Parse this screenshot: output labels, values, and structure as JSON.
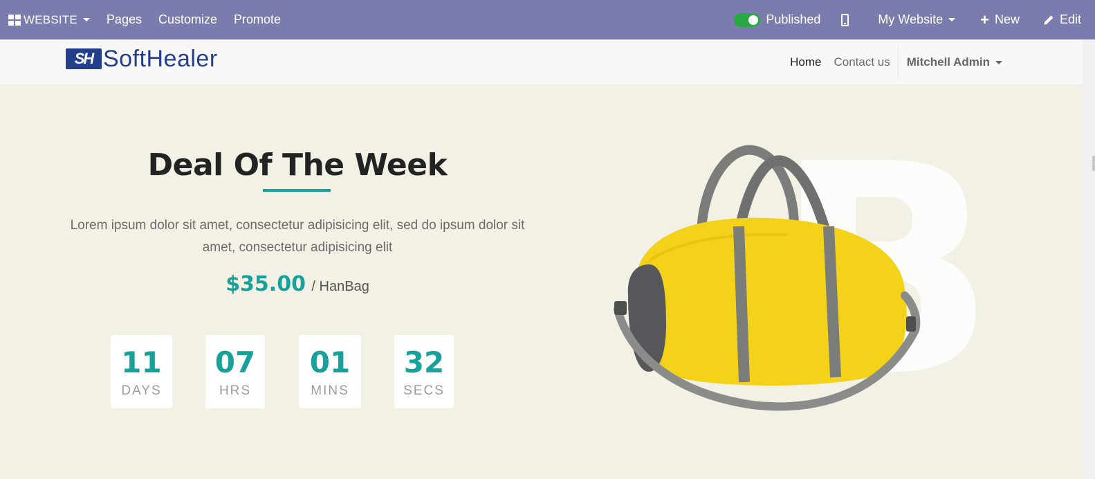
{
  "adminbar": {
    "website_label": "WEBSITE",
    "pages_label": "Pages",
    "customize_label": "Customize",
    "promote_label": "Promote",
    "published_label": "Published",
    "my_website_label": "My Website",
    "new_label": "New",
    "edit_label": "Edit",
    "accent_color": "#7c7bad",
    "toggle_color": "#28a745"
  },
  "header": {
    "logo_text": "SoftHealer",
    "nav": {
      "home": "Home",
      "contact": "Contact us",
      "user": "Mitchell Admin"
    }
  },
  "hero": {
    "title": "Deal Of The Week",
    "description": "Lorem ipsum dolor sit amet, consectetur adipisicing elit, sed do ipsum dolor sit amet, consectetur adipisicing elit",
    "price": "$35.00",
    "price_unit": "/ HanBag",
    "accent_color": "#17a19b",
    "countdown": [
      {
        "value": "11",
        "label": "DAYS"
      },
      {
        "value": "07",
        "label": "HRS"
      },
      {
        "value": "01",
        "label": "MINS"
      },
      {
        "value": "32",
        "label": "SECS"
      }
    ],
    "bg_letter": "B",
    "image": "yellow-duffel-bag"
  }
}
